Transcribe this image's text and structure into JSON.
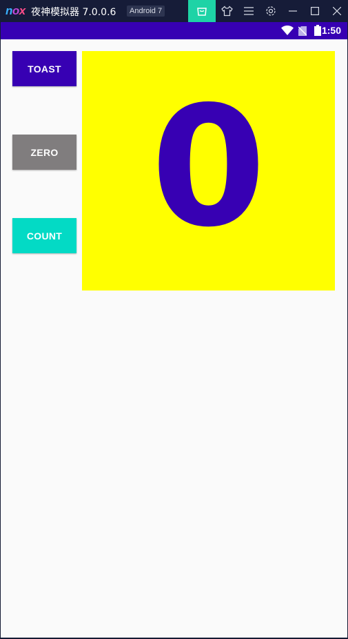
{
  "emulator": {
    "logo": [
      "n",
      "o",
      "x"
    ],
    "title": "夜神模拟器 7.0.0.6",
    "badge": "Android 7",
    "controls": [
      "shop-icon",
      "shirt-icon",
      "menu-icon",
      "settings-icon",
      "minimize-icon",
      "maximize-icon",
      "close-icon"
    ]
  },
  "statusbar": {
    "time": "1:50",
    "icons": [
      "wifi-icon",
      "no-sim-icon",
      "battery-icon"
    ]
  },
  "app": {
    "buttons": {
      "toast": "TOAST",
      "zero": "ZERO",
      "count": "COUNT"
    },
    "count_value": "0"
  },
  "colors": {
    "primary": "#3700b3",
    "zero_button": "#807d7e",
    "count_button": "#03dac5",
    "count_background": "#ffff00",
    "emulator_accent": "#1ed3a6"
  }
}
